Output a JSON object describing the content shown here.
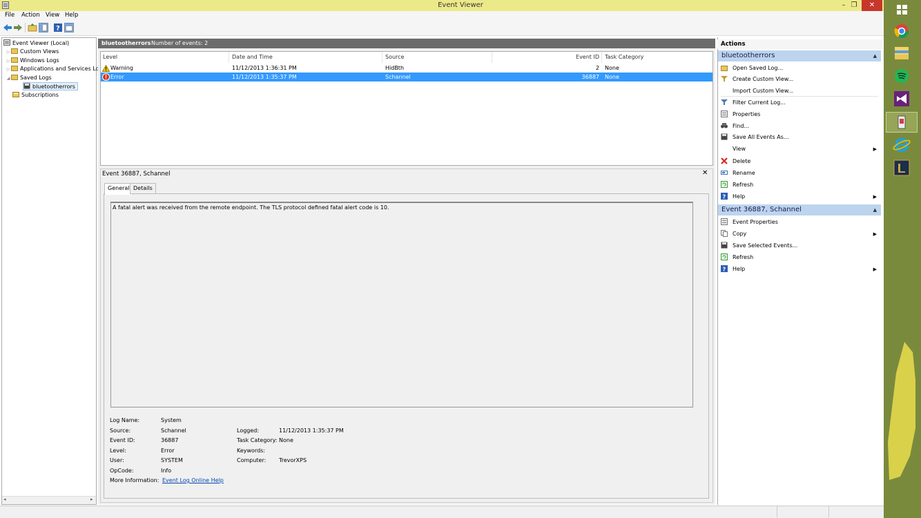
{
  "window": {
    "title": "Event Viewer",
    "minimize": "–",
    "restore": "❐",
    "close": "✕"
  },
  "menu": [
    "File",
    "Action",
    "View",
    "Help"
  ],
  "tree": {
    "root": "Event Viewer (Local)",
    "items": [
      {
        "label": "Custom Views",
        "icon": "folder-icon"
      },
      {
        "label": "Windows Logs",
        "icon": "folder-icon"
      },
      {
        "label": "Applications and Services Lo",
        "icon": "folder-icon"
      },
      {
        "label": "Saved Logs",
        "icon": "folder-icon"
      },
      {
        "label": "bluetootherrors",
        "icon": "log-icon"
      },
      {
        "label": "Subscriptions",
        "icon": "subscriptions-icon"
      }
    ]
  },
  "log_header": {
    "name": "bluetootherrors",
    "count": "Number of events: 2"
  },
  "columns": [
    "Level",
    "Date and Time",
    "Source",
    "Event ID",
    "Task Category"
  ],
  "rows": [
    {
      "level": "Warning",
      "date": "11/12/2013 1:36:31 PM",
      "source": "HidBth",
      "event_id": "2",
      "task": "None"
    },
    {
      "level": "Error",
      "date": "11/12/2013 1:35:37 PM",
      "source": "Schannel",
      "event_id": "36887",
      "task": "None"
    }
  ],
  "detail": {
    "title": "Event 36887, Schannel",
    "tabs": [
      "General",
      "Details"
    ],
    "message": "A fatal alert was received from the remote endpoint. The TLS protocol defined fatal alert code is 10.",
    "fields": {
      "log_name_label": "Log Name:",
      "log_name": "System",
      "source_label": "Source:",
      "source": "Schannel",
      "logged_label": "Logged:",
      "logged": "11/12/2013 1:35:37 PM",
      "event_id_label": "Event ID:",
      "event_id": "36887",
      "task_label": "Task Category:",
      "task": "None",
      "level_label": "Level:",
      "level": "Error",
      "keywords_label": "Keywords:",
      "user_label": "User:",
      "user": "SYSTEM",
      "computer_label": "Computer:",
      "computer": "TrevorXPS",
      "opcode_label": "OpCode:",
      "opcode": "Info",
      "more_label": "More Information:",
      "more_link": "Event Log Online Help"
    }
  },
  "actions": {
    "header": "Actions",
    "section1": {
      "title": "bluetootherrors",
      "items": [
        "Open Saved Log...",
        "Create Custom View...",
        "Import Custom View...",
        "Filter Current Log...",
        "Properties",
        "Find...",
        "Save All Events As...",
        "View",
        "Delete",
        "Rename",
        "Refresh",
        "Help"
      ]
    },
    "section2": {
      "title": "Event 36887, Schannel",
      "items": [
        "Event Properties",
        "Copy",
        "Save Selected Events...",
        "Refresh",
        "Help"
      ]
    }
  },
  "colors": {
    "titlebar": "#ece989",
    "selection": "#3399ff",
    "section_head": "#bcd4ee",
    "taskbar": "#7a8a3d"
  }
}
